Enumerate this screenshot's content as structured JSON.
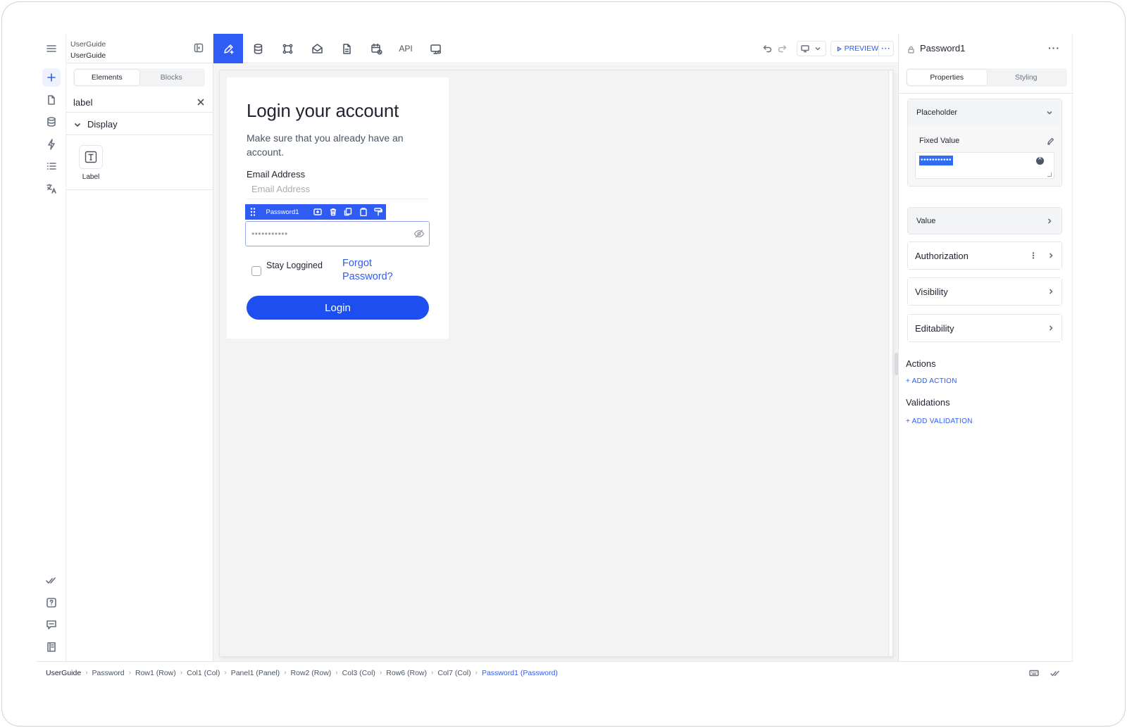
{
  "project": {
    "line1": "UserGuide",
    "line2": "UserGuide"
  },
  "left_panel": {
    "tabs": [
      {
        "label": "Elements",
        "active": true
      },
      {
        "label": "Blocks",
        "active": false
      }
    ],
    "search_value": "label",
    "group_title": "Display",
    "elements": [
      {
        "label": "Label",
        "icon": "text-icon"
      }
    ]
  },
  "toolbar": {
    "api_label": "API",
    "preview_label": "PREVIEW",
    "more_label": "···"
  },
  "canvas": {
    "title": "Login your account",
    "subtitle": "Make sure that you already have an account.",
    "email_label": "Email Address",
    "email_placeholder": "Email Address",
    "selected_element": "Password1",
    "password_placeholder": "•••••••••••",
    "stay_logged_label": "Stay Loggined",
    "forgot_label": "Forgot Password?",
    "login_label": "Login"
  },
  "right_panel": {
    "title": "Password1",
    "tabs": [
      {
        "label": "Properties",
        "active": true
      },
      {
        "label": "Styling",
        "active": false
      }
    ],
    "placeholder_section": "Placeholder",
    "fixed_value_label": "Fixed Value",
    "fixed_value_text": "•••••••••••",
    "value_section": "Value",
    "authorization_section": "Authorization",
    "visibility_section": "Visibility",
    "editability_section": "Editability",
    "actions_title": "Actions",
    "add_action": "+ ADD ACTION",
    "validations_title": "Validations",
    "add_validation": "+ ADD VALIDATION"
  },
  "breadcrumb": [
    "UserGuide",
    "Password",
    "Row1 (Row)",
    "Col1 (Col)",
    "Panel1 (Panel)",
    "Row2 (Row)",
    "Col3 (Col)",
    "Row6 (Row)",
    "Col7 (Col)",
    "Password1 (Password)"
  ],
  "colors": {
    "accent": "#2f5cf5",
    "login_button": "#1d4ff0",
    "canvas_bg": "#f4f4f5"
  }
}
